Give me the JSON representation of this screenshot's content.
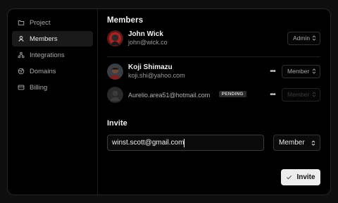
{
  "sidebar": {
    "items": [
      {
        "label": "Project",
        "icon": "folder-icon",
        "active": false
      },
      {
        "label": "Members",
        "icon": "user-icon",
        "active": true
      },
      {
        "label": "Integrations",
        "icon": "integrations-icon",
        "active": false
      },
      {
        "label": "Domains",
        "icon": "globe-icon",
        "active": false
      },
      {
        "label": "Billing",
        "icon": "credit-card-icon",
        "active": false
      }
    ]
  },
  "members": {
    "title": "Members",
    "owner": {
      "name": "John Wick",
      "email": "john@wick.co",
      "role": "Admin"
    },
    "list": [
      {
        "name": "Koji Shimazu",
        "email": "koji.shi@yahoo.com",
        "role": "Member",
        "more": "•••"
      },
      {
        "email": "Aurelio.area51@hotmail.com",
        "badge": "PENDING",
        "role": "Member",
        "more": "•••"
      }
    ]
  },
  "invite": {
    "title": "Invite",
    "input_value": "winst.scott@gmail.com",
    "role": "Member",
    "button_label": "Invite"
  },
  "colors": {
    "background": "#000000",
    "active_nav": "#1a1a1a",
    "button": "#ededed",
    "badge": "#2c2c2c"
  }
}
